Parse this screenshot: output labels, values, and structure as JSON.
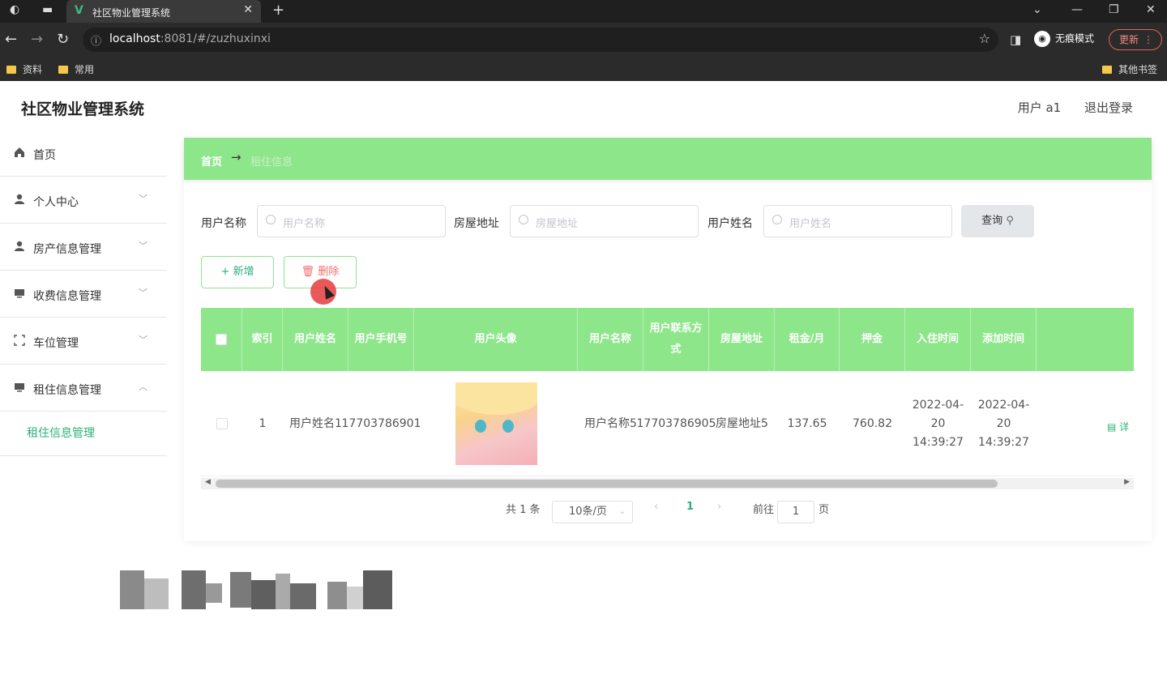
{
  "browser": {
    "tab_title": "社区物业管理系统",
    "tab_favicon": "V",
    "url_host": "localhost",
    "url_rest": ":8081/#/zuzhuxinxi",
    "incognito_label": "无痕模式",
    "update_label": "更新",
    "bookmarks": [
      "资料",
      "常用"
    ],
    "other_bookmarks": "其他书签"
  },
  "app": {
    "title": "社区物业管理系统",
    "user_label": "用户 a1",
    "logout_label": "退出登录"
  },
  "sidebar": {
    "items": [
      {
        "label": "首页",
        "icon": "home-icon"
      },
      {
        "label": "个人中心",
        "icon": "user-icon"
      },
      {
        "label": "房产信息管理",
        "icon": "user-icon"
      },
      {
        "label": "收费信息管理",
        "icon": "monitor-icon"
      },
      {
        "label": "车位管理",
        "icon": "frame-icon"
      },
      {
        "label": "租住信息管理",
        "icon": "monitor-icon"
      }
    ],
    "sub_item": "租住信息管理"
  },
  "breadcrumb": {
    "home": "首页",
    "arrow": "→",
    "current": "租住信息"
  },
  "filters": [
    {
      "label": "用户名称",
      "placeholder": "用户名称"
    },
    {
      "label": "房屋地址",
      "placeholder": "房屋地址"
    },
    {
      "label": "用户姓名",
      "placeholder": "用户姓名"
    }
  ],
  "buttons": {
    "query": "查询",
    "add": "+ 新增",
    "delete": "删除"
  },
  "table": {
    "headers": [
      "索引",
      "用户姓名",
      "用户手机号",
      "用户头像",
      "用户名称",
      "用户联系方式",
      "房屋地址",
      "租金/月",
      "押金",
      "入住时间",
      "添加时间"
    ],
    "rows": [
      {
        "index": "1",
        "name": "用户姓名1",
        "phone": "17703786901",
        "username": "用户名称5",
        "contact": "17703786905",
        "address": "房屋地址5",
        "rent": "137.65",
        "deposit": "760.82",
        "checkin": "2022-04-20 14:39:27",
        "added": "2022-04-20 14:39:27"
      }
    ],
    "detail_label": "详"
  },
  "pagination": {
    "total": "共 1 条",
    "page_size": "10条/页",
    "current": "1",
    "goto_prefix": "前往",
    "goto_value": "1",
    "goto_suffix": "页"
  },
  "colors": {
    "accent": "#8ee68b",
    "link": "#2ab07a",
    "danger": "#f56c6c"
  }
}
